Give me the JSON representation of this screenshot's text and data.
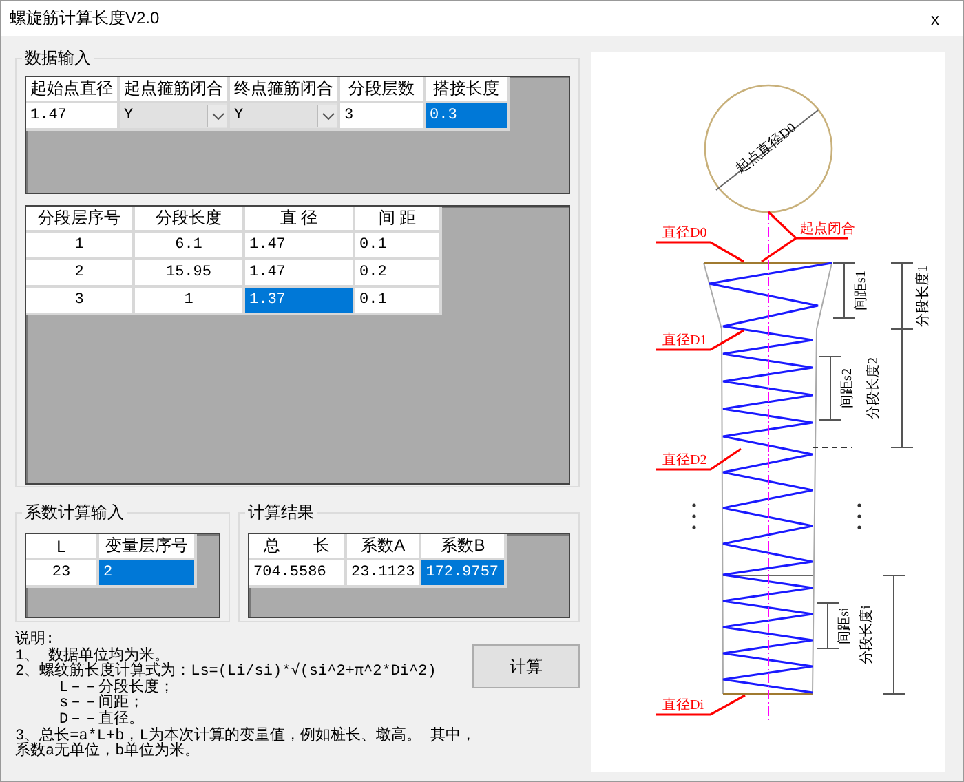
{
  "window": {
    "title": "螺旋筋计算长度V2.0",
    "close": "x"
  },
  "data_input": {
    "title": "数据输入",
    "columns": [
      "起始点直径",
      "起点箍筋闭合",
      "终点箍筋闭合",
      "分段层数",
      "搭接长度"
    ],
    "rows": [
      [
        {
          "text": "1.47",
          "kind": "text",
          "selected": false
        },
        {
          "text": "Y",
          "kind": "combo",
          "selected": false
        },
        {
          "text": "Y",
          "kind": "combo",
          "selected": false
        },
        {
          "text": "3",
          "kind": "text",
          "selected": false
        },
        {
          "text": "0.3",
          "kind": "text",
          "selected": true
        }
      ]
    ]
  },
  "segments": {
    "columns": [
      "分段层序号",
      "分段长度",
      "直 径",
      "间 距"
    ],
    "rows": [
      [
        {
          "text": "1",
          "kind": "text",
          "selected": false
        },
        {
          "text": "6.1",
          "kind": "text",
          "selected": false
        },
        {
          "text": "1.47",
          "kind": "text",
          "selected": false
        },
        {
          "text": "0.1",
          "kind": "text",
          "selected": false
        }
      ],
      [
        {
          "text": "2",
          "kind": "text",
          "selected": false
        },
        {
          "text": "15.95",
          "kind": "text",
          "selected": false
        },
        {
          "text": "1.47",
          "kind": "text",
          "selected": false
        },
        {
          "text": "0.2",
          "kind": "text",
          "selected": false
        }
      ],
      [
        {
          "text": "3",
          "kind": "text",
          "selected": false
        },
        {
          "text": "1",
          "kind": "text",
          "selected": false
        },
        {
          "text": "1.37",
          "kind": "text",
          "selected": true
        },
        {
          "text": "0.1",
          "kind": "text",
          "selected": false
        }
      ]
    ]
  },
  "coefficient_input": {
    "title": "系数计算输入",
    "columns": [
      "L",
      "变量层序号"
    ],
    "rows": [
      [
        {
          "text": "23",
          "kind": "text",
          "selected": false
        },
        {
          "text": "2",
          "kind": "text",
          "selected": true
        }
      ]
    ]
  },
  "results": {
    "title": "计算结果",
    "columns": [
      "总　　长",
      "系数A",
      "系数B"
    ],
    "rows": [
      [
        {
          "text": "704.5586",
          "kind": "text",
          "selected": false
        },
        {
          "text": "23.1123",
          "kind": "text",
          "selected": false
        },
        {
          "text": "172.9757",
          "kind": "text",
          "selected": true
        }
      ]
    ]
  },
  "notes": [
    {
      "text": "说明:",
      "kind": "main"
    },
    {
      "text": "1、 数据单位均为米。",
      "kind": "main"
    },
    {
      "text": "2、螺纹筋长度计算式为：Ls=(Li/si)*√(si^2+π^2*Di^2)",
      "kind": "main"
    },
    {
      "text": "L－－分段长度；",
      "kind": "sub"
    },
    {
      "text": "s－－间距；",
      "kind": "sub"
    },
    {
      "text": "D－－直径。",
      "kind": "sub"
    },
    {
      "text": "3、总长=a*L+b，L为本次计算的变量值，例如桩长、墩高。 其中，",
      "kind": "main"
    },
    {
      "text": "系数a无单位，b单位为米。",
      "kind": "main"
    }
  ],
  "calculate_button": "计算",
  "diagram": {
    "labels": {
      "start_diameter": "起点直径D0",
      "diameter_d0": "直径D0",
      "start_closure": "起点闭合",
      "diameter_d1": "直径D1",
      "diameter_d2": "直径D2",
      "diameter_di": "直径Di",
      "spacing_s1": "间距s1",
      "segment_length_1": "分段长度1",
      "spacing_s2": "间距s2",
      "segment_length_2": "分段长度2",
      "spacing_si": "间距si",
      "segment_length_i": "分段长度i"
    }
  }
}
